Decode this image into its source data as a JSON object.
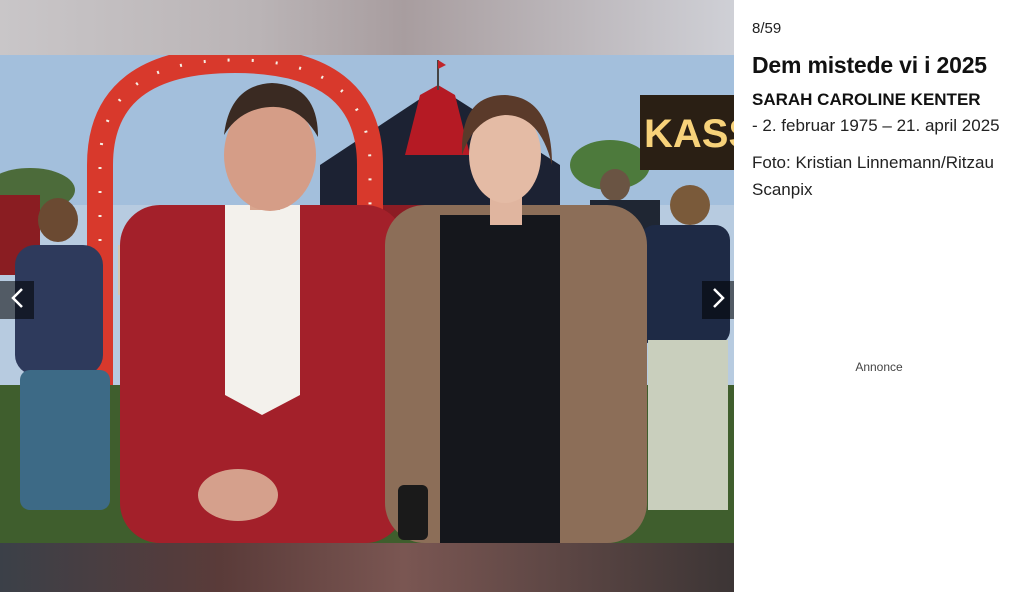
{
  "gallery": {
    "counter": "8/59",
    "title": "Dem mistede vi i 2025"
  },
  "slide": {
    "name": "SARAH CAROLINE KENTER",
    "dates": "- 2. februar 1975 – 21. april 2025",
    "credit": "Foto: Kristian Linnemann/Ritzau Scanpix",
    "sign_text": "KASS"
  },
  "ad": {
    "label": "Annonce"
  },
  "icons": {
    "prev": "chevron-left-icon",
    "next": "chevron-right-icon"
  },
  "colors": {
    "arrow_bg": "#000000",
    "arch_red": "#d8392c",
    "jacket_red": "#a3202a",
    "coat_brown": "#8c6e58"
  }
}
